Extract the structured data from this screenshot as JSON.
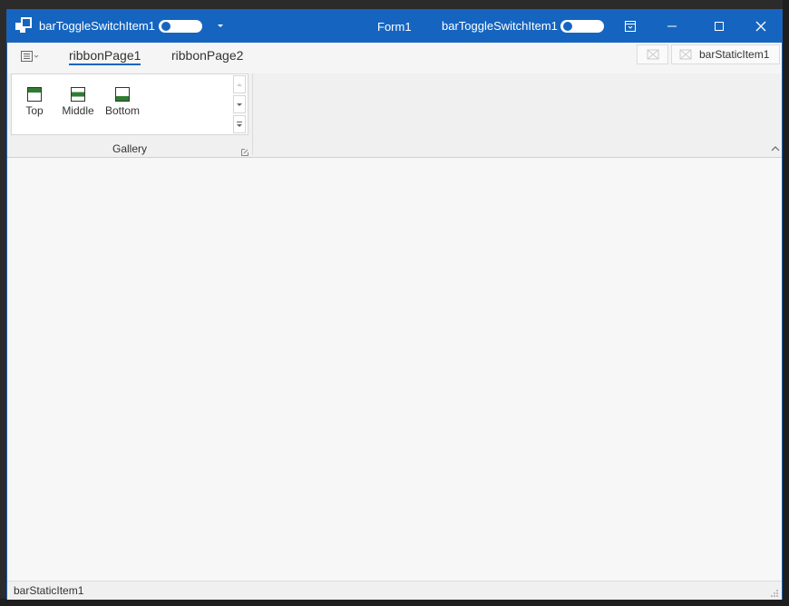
{
  "titlebar": {
    "toggle_item_label": "barToggleSwitchItem1",
    "form_title": "Form1",
    "toggle_item_label_right": "barToggleSwitchItem1"
  },
  "ribbon": {
    "tabs": [
      {
        "label": "ribbonPage1",
        "active": true
      },
      {
        "label": "ribbonPage2",
        "active": false
      }
    ],
    "header_static_item": "barStaticItem1",
    "gallery": {
      "items": [
        {
          "label": "Top",
          "icon": "align-top-icon"
        },
        {
          "label": "Middle",
          "icon": "align-middle-icon"
        },
        {
          "label": "Bottom",
          "icon": "align-bottom-icon"
        }
      ],
      "group_label": "Gallery"
    }
  },
  "statusbar": {
    "static_item": "barStaticItem1"
  },
  "colors": {
    "titlebar": "#1565c0",
    "accent_green": "#2e7d32",
    "active_tab_underline": "#1565c0"
  }
}
